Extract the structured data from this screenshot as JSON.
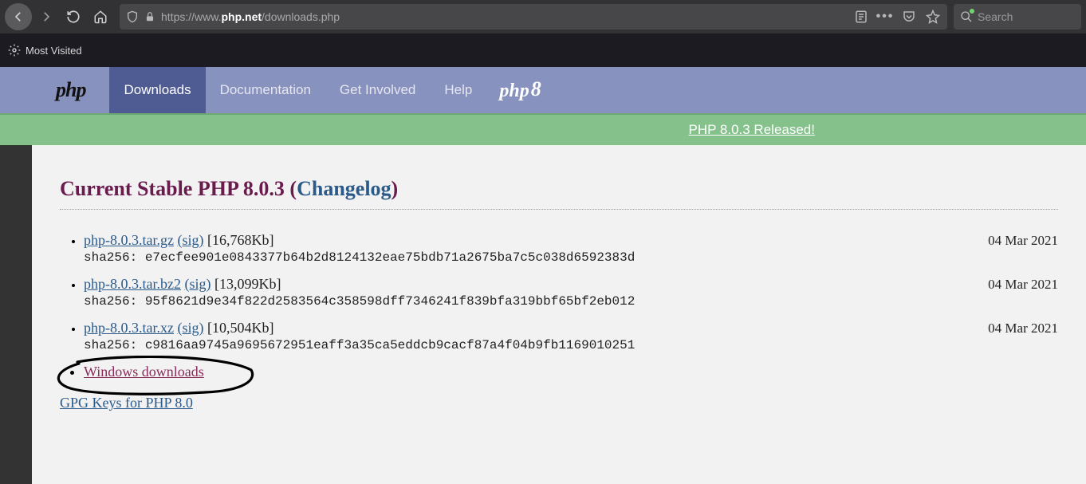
{
  "browser": {
    "url_prefix": "https://www.",
    "url_domain": "php.net",
    "url_path": "/downloads.php",
    "search_placeholder": "Search",
    "bookmarks": {
      "most_visited": "Most Visited"
    }
  },
  "nav": {
    "items": [
      "Downloads",
      "Documentation",
      "Get Involved",
      "Help"
    ],
    "active_index": 0
  },
  "announce": {
    "text": "PHP 8.0.3 Released!"
  },
  "section": {
    "title_prefix": "Current Stable PHP 8.0.3",
    "changelog_label": "Changelog"
  },
  "downloads": [
    {
      "file": "php-8.0.3.tar.gz",
      "sig": "(sig)",
      "size": "[16,768Kb]",
      "date": "04 Mar 2021",
      "sha_label": "sha256:",
      "sha": "e7ecfee901e0843377b64b2d8124132eae75bdb71a2675ba7c5c038d6592383d"
    },
    {
      "file": "php-8.0.3.tar.bz2",
      "sig": "(sig)",
      "size": "[13,099Kb]",
      "date": "04 Mar 2021",
      "sha_label": "sha256:",
      "sha": "95f8621d9e34f822d2583564c358598dff7346241f839bfa319bbf65bf2eb012"
    },
    {
      "file": "php-8.0.3.tar.xz",
      "sig": "(sig)",
      "size": "[10,504Kb]",
      "date": "04 Mar 2021",
      "sha_label": "sha256:",
      "sha": "c9816aa9745a9695672951eaff3a35ca5eddcb9cacf87a4f04b9fb1169010251"
    }
  ],
  "windows_link": "Windows downloads",
  "gpg_link": "GPG Keys for PHP 8.0"
}
